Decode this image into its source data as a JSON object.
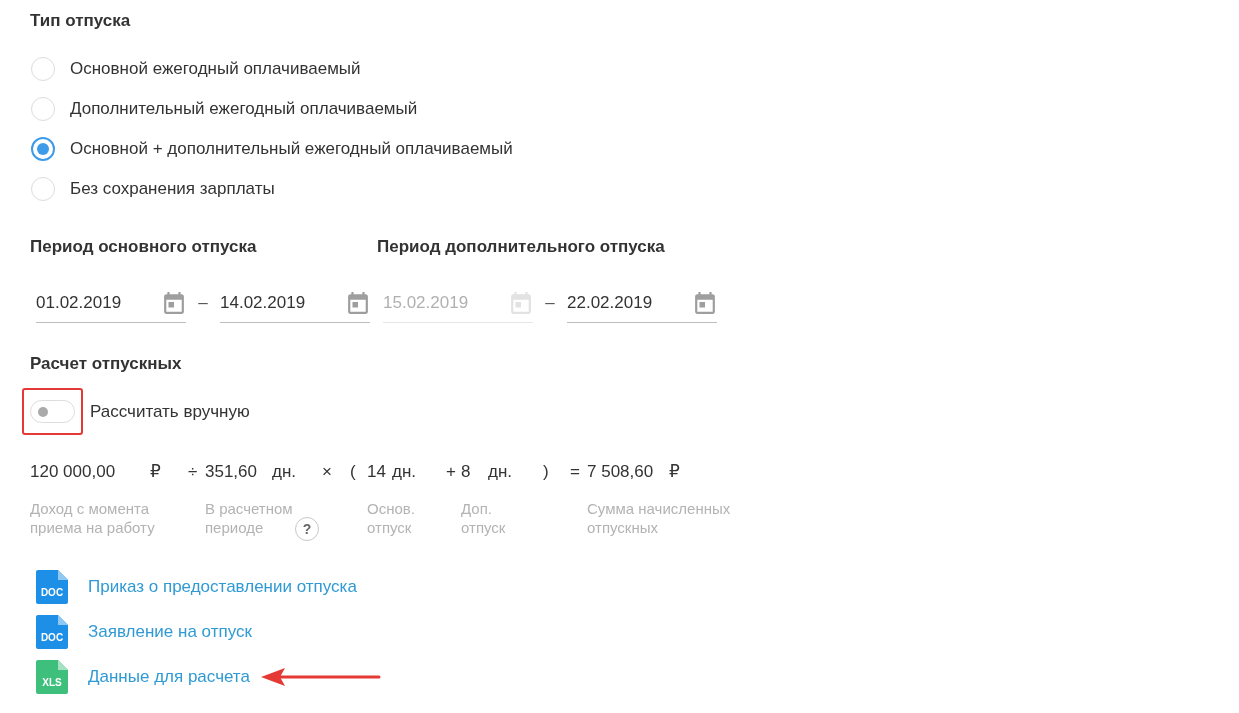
{
  "leave_type": {
    "title": "Тип отпуска",
    "options": [
      {
        "label": "Основной ежегодный оплачиваемый",
        "selected": false
      },
      {
        "label": "Дополнительный ежегодный оплачиваемый",
        "selected": false
      },
      {
        "label": "Основной + дополнительный ежегодный оплачиваемый",
        "selected": true
      },
      {
        "label": "Без сохранения зарплаты",
        "selected": false
      }
    ]
  },
  "periods": [
    {
      "title": "Период основного отпуска",
      "start": {
        "value": "01.02.2019",
        "disabled": false
      },
      "separator": "–",
      "end": {
        "value": "14.02.2019",
        "disabled": false
      }
    },
    {
      "title": "Период дополнительного отпуска",
      "start": {
        "value": "15.02.2019",
        "disabled": true
      },
      "separator": "–",
      "end": {
        "value": "22.02.2019",
        "disabled": false
      }
    }
  ],
  "calculation": {
    "title": "Расчет отпускных",
    "manual_toggle": {
      "label": "Рассчитать вручную",
      "on": false,
      "highlighted": true
    },
    "formula": [
      {
        "kind": "term",
        "value": "120 000,00",
        "unit": "₽",
        "caption": "Доход с момента приема на работу"
      },
      {
        "kind": "operator",
        "symbol": "÷"
      },
      {
        "kind": "term",
        "value": "351,60",
        "unit": "дн.",
        "caption": "В расчетном периоде",
        "help": "?"
      },
      {
        "kind": "operator",
        "symbol": "×"
      },
      {
        "kind": "operator",
        "symbol": "("
      },
      {
        "kind": "term",
        "value": "14",
        "unit": "дн.",
        "caption": "Основ. отпуск"
      },
      {
        "kind": "operator",
        "symbol": "+"
      },
      {
        "kind": "term",
        "value": "8",
        "unit": "дн.",
        "caption": "Доп. отпуск"
      },
      {
        "kind": "operator",
        "symbol": ")"
      },
      {
        "kind": "operator",
        "symbol": "="
      },
      {
        "kind": "term",
        "value": "7 508,60",
        "unit": "₽",
        "caption": "Сумма начисленных отпускных"
      }
    ]
  },
  "documents": [
    {
      "kind": "doc",
      "badge": "DOC",
      "title": "Приказ о предоставлении отпуска",
      "pointed": false
    },
    {
      "kind": "doc",
      "badge": "DOC",
      "title": "Заявление на отпуск",
      "pointed": false
    },
    {
      "kind": "xls",
      "badge": "XLS",
      "title": "Данные для расчета",
      "pointed": true
    }
  ]
}
